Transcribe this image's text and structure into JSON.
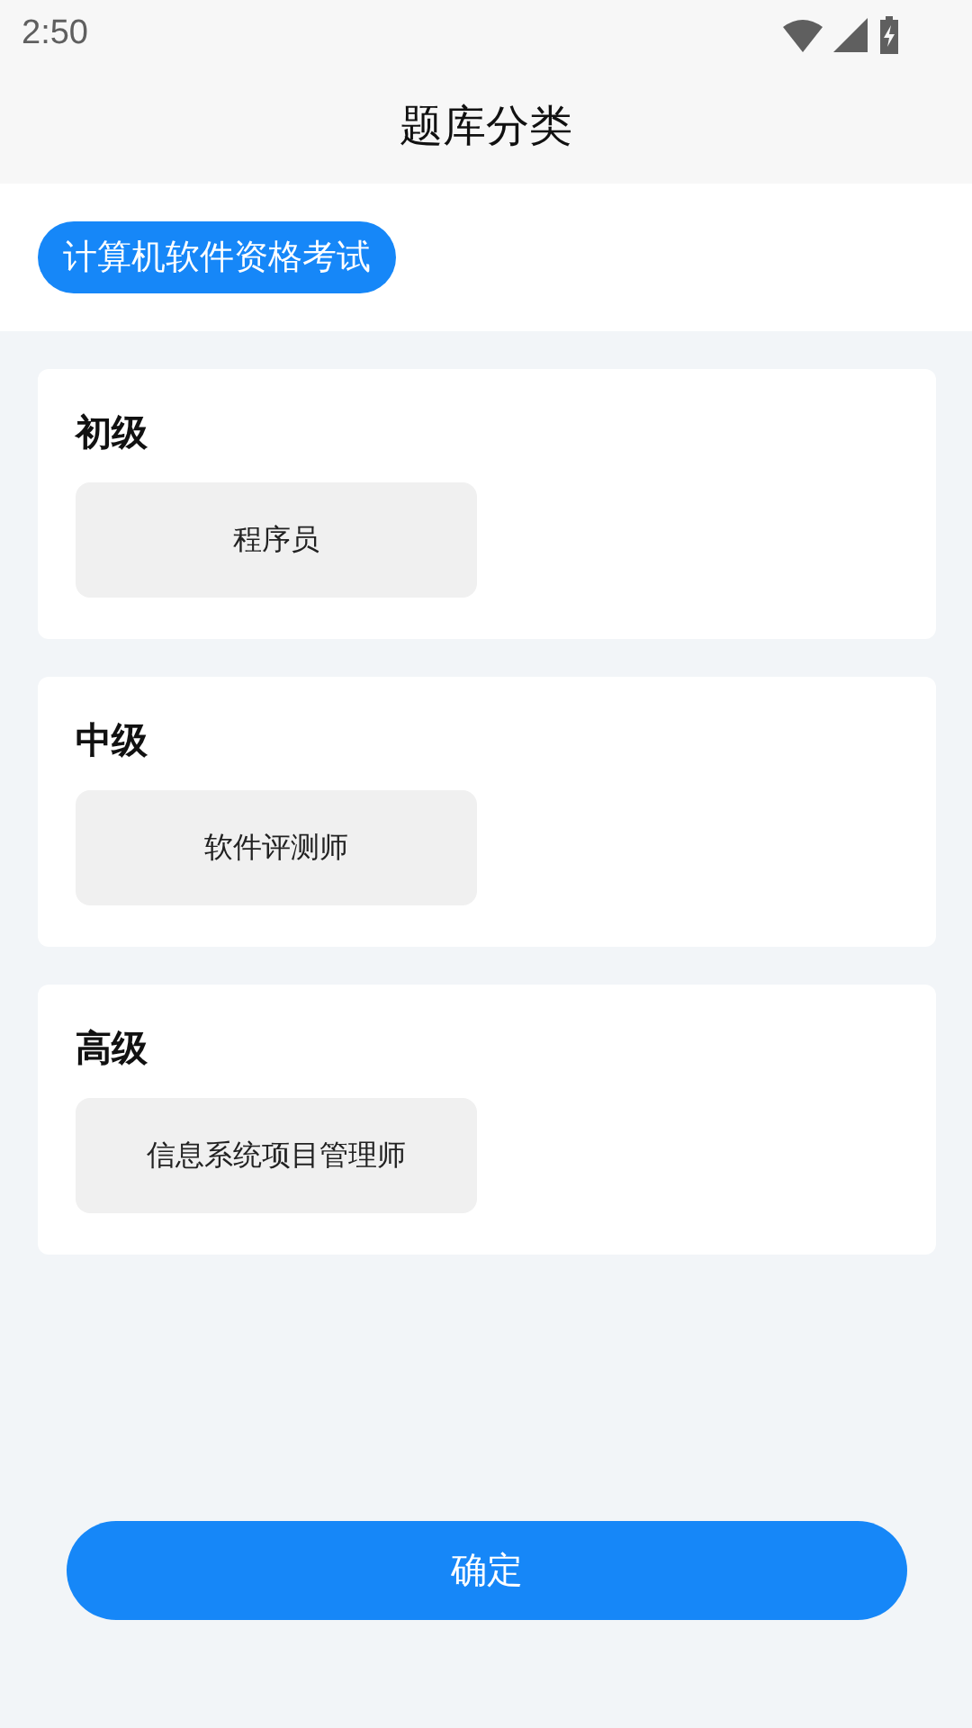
{
  "status_bar": {
    "time": "2:50"
  },
  "header": {
    "title": "题库分类"
  },
  "category_tabs": [
    {
      "label": "计算机软件资格考试",
      "selected": true
    }
  ],
  "levels": [
    {
      "title": "初级",
      "options": [
        {
          "label": "程序员",
          "selected": false
        }
      ]
    },
    {
      "title": "中级",
      "options": [
        {
          "label": "软件评测师",
          "selected": false
        }
      ]
    },
    {
      "title": "高级",
      "options": [
        {
          "label": "信息系统项目管理师",
          "selected": false
        }
      ]
    }
  ],
  "confirm_button": {
    "label": "确定"
  }
}
